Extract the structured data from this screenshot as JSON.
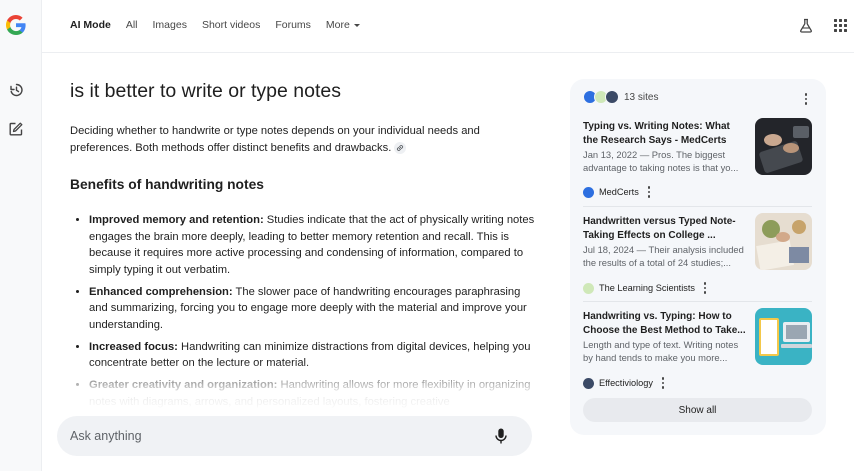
{
  "nav": {
    "tabs": [
      {
        "label": "AI Mode",
        "active": true
      },
      {
        "label": "Images",
        "active": false
      },
      {
        "label": "Short videos",
        "active": false
      },
      {
        "label": "Forums",
        "active": false
      }
    ],
    "all_label": "All",
    "more_label": "More",
    "icons": {
      "left_logo": "google-g-logo",
      "history": "history-icon",
      "new_chat": "edit-icon",
      "labs": "labs-flask-icon",
      "apps": "apps-grid-icon"
    }
  },
  "answer": {
    "query": "is it better to write or type notes",
    "intro": "Deciding whether to handwrite or type notes depends on your individual needs and preferences. Both methods offer distinct benefits and drawbacks.",
    "section_heading": "Benefits of handwriting notes",
    "points": [
      {
        "term": "Improved memory and retention:",
        "text": " Studies indicate that the act of physically writing notes engages the brain more deeply, leading to better memory retention and recall. This is because it requires more active processing and condensing of information, compared to simply typing it out verbatim."
      },
      {
        "term": "Enhanced comprehension:",
        "text": " The slower pace of handwriting encourages paraphrasing and summarizing, forcing you to engage more deeply with the material and improve your understanding."
      },
      {
        "term": "Increased focus:",
        "text": " Handwriting can minimize distractions from digital devices, helping you concentrate better on the lecture or material."
      },
      {
        "term": "Greater creativity and organization:",
        "text": " Handwriting allows for more flexibility in organizing notes with diagrams, arrows, and personalized layouts, fostering creative"
      }
    ]
  },
  "askbar": {
    "placeholder": "Ask anything"
  },
  "sources": {
    "count_label": "13 sites",
    "show_all_label": "Show all",
    "items": [
      {
        "title": "Typing vs. Writing Notes: What the Research Says - MedCerts",
        "snippet": "Jan 13, 2022 — Pros. The biggest advantage to taking notes is that yo...",
        "source": "MedCerts",
        "favicon_color": "#2d6fe0"
      },
      {
        "title": "Handwritten versus Typed Note-Taking Effects on College ...",
        "snippet": "Jul 18, 2024 — Their analysis included the results of a total of 24 studies;...",
        "source": "The Learning Scientists",
        "favicon_color": "#7ab648"
      },
      {
        "title": "Handwriting vs. Typing: How to Choose the Best Method to Take...",
        "snippet": "Length and type of text. Writing notes by hand tends to make you more...",
        "source": "Effectiviology",
        "favicon_color": "#3b4a66"
      }
    ]
  },
  "colors": {
    "accent_blue": "#1a73e8",
    "panel_bg": "#f5f7fa",
    "ask_bg": "#f0f2f5"
  }
}
